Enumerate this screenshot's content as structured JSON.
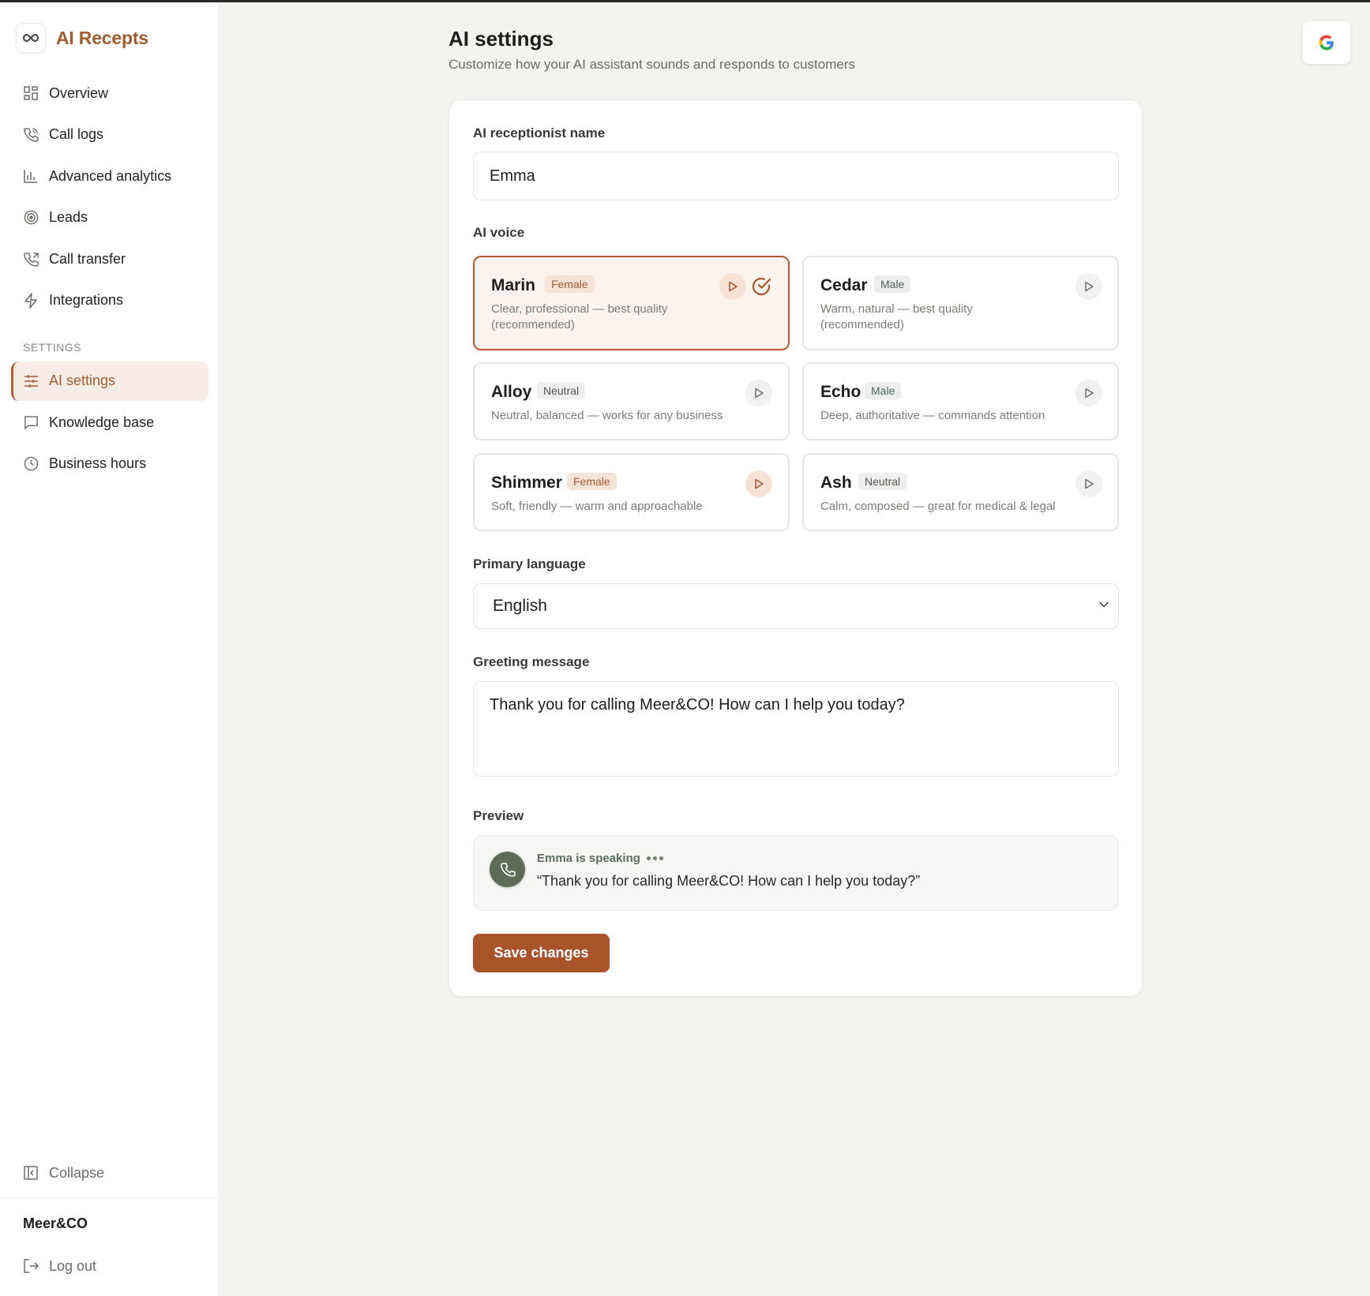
{
  "brand": {
    "name": "AI Recepts",
    "logo_icon": "infinity-icon"
  },
  "nav": {
    "items": [
      {
        "label": "Overview",
        "icon": "grid-icon"
      },
      {
        "label": "Call logs",
        "icon": "phone-icon"
      },
      {
        "label": "Advanced analytics",
        "icon": "bar-chart-icon"
      },
      {
        "label": "Leads",
        "icon": "target-icon"
      },
      {
        "label": "Call transfer",
        "icon": "phone-forward-icon"
      },
      {
        "label": "Integrations",
        "icon": "lightning-icon"
      }
    ],
    "settings_heading": "SETTINGS",
    "settings_items": [
      {
        "label": "AI settings",
        "icon": "sliders-icon",
        "active": true
      },
      {
        "label": "Knowledge base",
        "icon": "message-square-icon"
      },
      {
        "label": "Business hours",
        "icon": "clock-icon"
      }
    ],
    "collapse_label": "Collapse",
    "company": "Meer&CO",
    "logout_label": "Log out"
  },
  "header": {
    "title": "AI settings",
    "subtitle": "Customize how your AI assistant sounds and responds to customers",
    "google_icon": "google-icon"
  },
  "form": {
    "name_label": "AI receptionist name",
    "name_value": "Emma",
    "voice_label": "AI voice",
    "voices": [
      {
        "name": "Marin",
        "gender": "Female",
        "desc_line1": "Clear, professional — best quality",
        "desc_line2": "(recommended)",
        "selected": true
      },
      {
        "name": "Cedar",
        "gender": "Male",
        "desc_line1": "Warm, natural — best quality",
        "desc_line2": "(recommended)",
        "selected": false
      },
      {
        "name": "Alloy",
        "gender": "Neutral",
        "desc_line1": "Neutral, balanced — works for any business",
        "selected": false
      },
      {
        "name": "Echo",
        "gender": "Male",
        "desc_line1": "Deep, authoritative — commands attention",
        "selected": false
      },
      {
        "name": "Shimmer",
        "gender": "Female",
        "desc_line1": "Soft, friendly — warm and approachable",
        "selected": false
      },
      {
        "name": "Ash",
        "gender": "Neutral",
        "desc_line1": "Calm, composed — great for medical & legal",
        "selected": false
      }
    ],
    "language_label": "Primary language",
    "language_value": "English",
    "greeting_label": "Greeting message",
    "greeting_value": "Thank you for calling Meer&CO! How can I help you today?",
    "preview_label": "Preview",
    "preview_speaking": "Emma is speaking",
    "preview_quote": "“Thank you for calling Meer&CO! How can I help you today?”",
    "save_label": "Save changes"
  },
  "colors": {
    "accent": "#a9532a",
    "selected_bg": "#fbf3ee",
    "sage": "#5e6b59"
  }
}
